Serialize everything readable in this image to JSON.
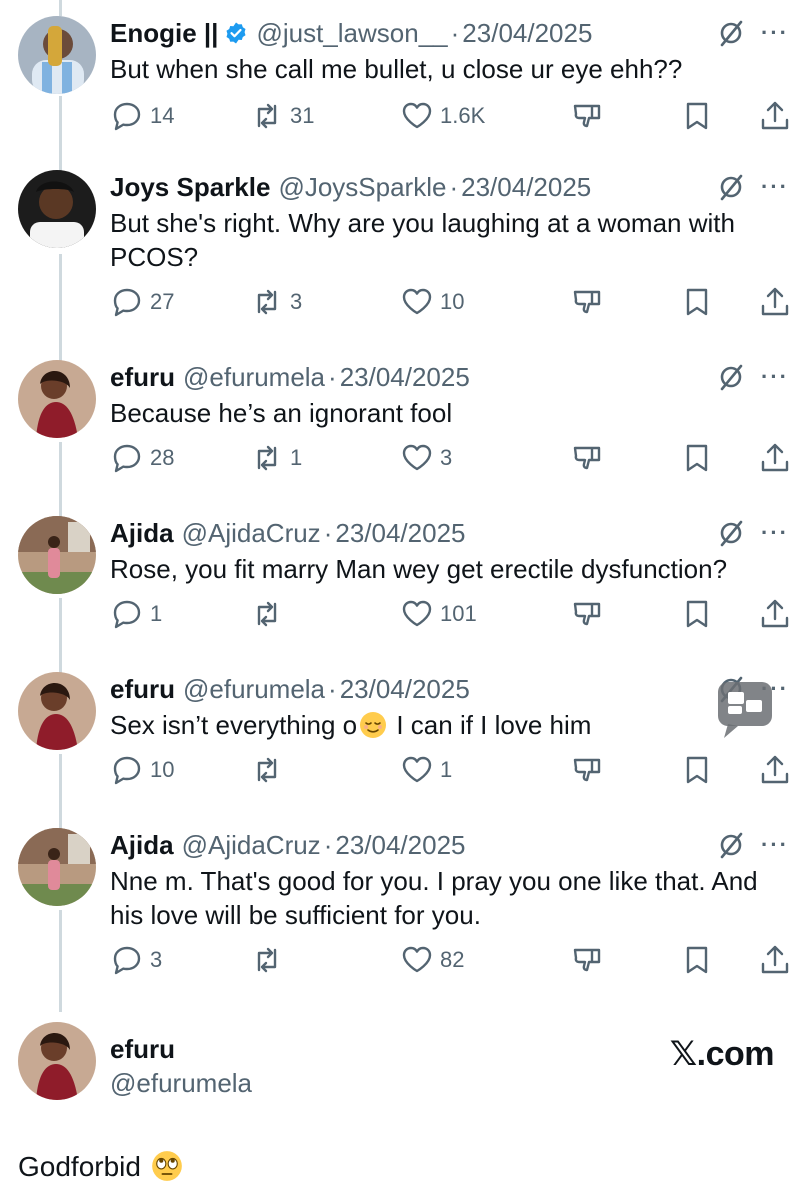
{
  "tweets": [
    {
      "name": "Enogie ||",
      "verified": true,
      "handle": "@just_lawson__",
      "date": "23/04/2025",
      "text": "But when she call me bullet, u close ur eye ehh??",
      "replies": "14",
      "reposts": "31",
      "likes": "1.6K"
    },
    {
      "name": "Joys Sparkle",
      "verified": false,
      "handle": "@JoysSparkle",
      "date": "23/04/2025",
      "text": "But she's right. Why are you laughing at a woman with PCOS?",
      "replies": "27",
      "reposts": "3",
      "likes": "10"
    },
    {
      "name": "efuru",
      "verified": false,
      "handle": "@efurumela",
      "date": "23/04/2025",
      "text": "Because he’s an ignorant fool",
      "replies": "28",
      "reposts": "1",
      "likes": "3"
    },
    {
      "name": "Ajida",
      "verified": false,
      "handle": "@AjidaCruz",
      "date": "23/04/2025",
      "text": "Rose, you fit marry Man wey get erectile dysfunction?",
      "replies": "1",
      "reposts": "",
      "likes": "101"
    },
    {
      "name": "efuru",
      "verified": false,
      "handle": "@efurumela",
      "date": "23/04/2025",
      "text_before_emoji": "Sex isn’t everything o",
      "emoji": "relieved-face",
      "text_after_emoji": " I can if I love him",
      "replies": "10",
      "reposts": "",
      "likes": "1"
    },
    {
      "name": "Ajida",
      "verified": false,
      "handle": "@AjidaCruz",
      "date": "23/04/2025",
      "text": "Nne m. That's good for you. I pray you one like that. And his love will be sufficient for you.",
      "replies": "3",
      "reposts": "",
      "likes": "82"
    }
  ],
  "final_post": {
    "name": "efuru",
    "handle": "@efurumela",
    "brand": "𝕏.com",
    "text": "Godforbid",
    "emoji": "face-with-rolling-eyes"
  },
  "separator": "·",
  "more_label": "···",
  "icons": {
    "reply": "reply-icon",
    "repost": "repost-icon",
    "like": "heart-icon",
    "dislike": "dislike-icon",
    "bookmark": "bookmark-icon",
    "share": "share-icon",
    "grok": "grok-icon",
    "more": "more-icon",
    "verified": "verified-badge-icon",
    "overlay": "chat-bubble-icon"
  },
  "colors": {
    "text": "#0f1419",
    "secondary": "#536471",
    "verified": "#1d9bf0",
    "thread_line": "#cfd9de"
  }
}
